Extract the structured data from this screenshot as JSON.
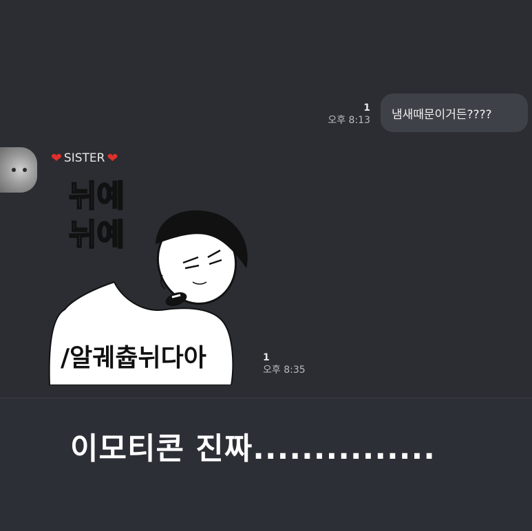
{
  "outgoing": {
    "text": "냄새때문이거든????",
    "unread": "1",
    "time": "오후 8:13"
  },
  "incoming": {
    "sender_name": "SISTER",
    "sender_heart_left": "❤",
    "sender_heart_right": "❤",
    "sticker_text_top_1": "뉘예",
    "sticker_text_top_2": "뉘예",
    "sticker_text_bottom": "/알궤츕뉘다아",
    "unread": "1",
    "time": "오후 8:35"
  },
  "caption": "이모티콘 진짜...............",
  "colors": {
    "chat_background": "#2b2d33",
    "bubble": "#3f4148",
    "heart": "#e0302a"
  }
}
